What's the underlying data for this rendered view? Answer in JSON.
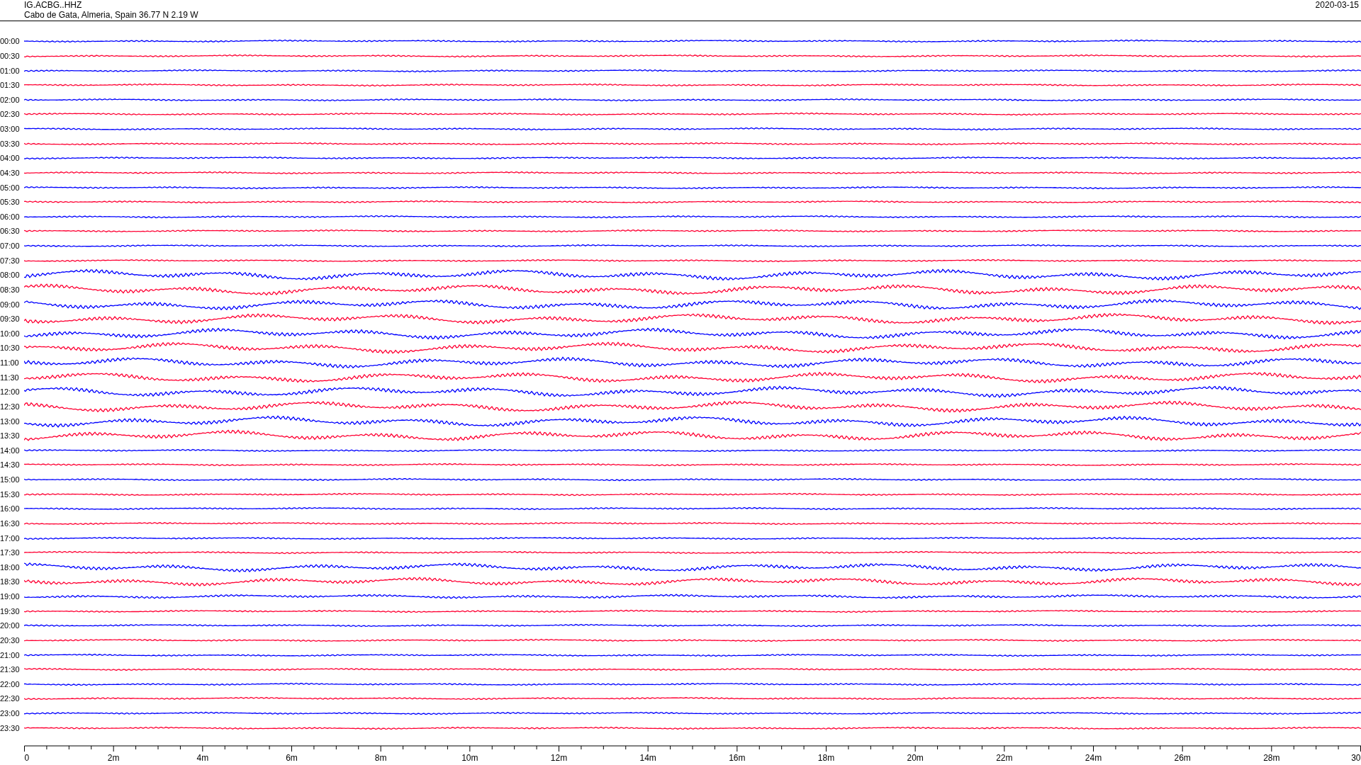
{
  "header": {
    "station": "IG.ACBG..HHZ",
    "location": "Cabo de Gata, Almeria, Spain  36.77 N 2.19 W",
    "date": "2020-03-15"
  },
  "traces": [
    {
      "time": "00:00",
      "color": "#0000ff"
    },
    {
      "time": "00:30",
      "color": "#ff0033"
    },
    {
      "time": "01:00",
      "color": "#0000ff"
    },
    {
      "time": "01:30",
      "color": "#ff0033"
    },
    {
      "time": "02:00",
      "color": "#0000ff"
    },
    {
      "time": "02:30",
      "color": "#ff0033"
    },
    {
      "time": "03:00",
      "color": "#0000ff"
    },
    {
      "time": "03:30",
      "color": "#ff0033"
    },
    {
      "time": "04:00",
      "color": "#0000ff"
    },
    {
      "time": "04:30",
      "color": "#ff0033"
    },
    {
      "time": "05:00",
      "color": "#0000ff"
    },
    {
      "time": "05:30",
      "color": "#ff0033"
    },
    {
      "time": "06:00",
      "color": "#0000ff"
    },
    {
      "time": "06:30",
      "color": "#ff0033"
    },
    {
      "time": "07:00",
      "color": "#0000ff"
    },
    {
      "time": "07:30",
      "color": "#ff0033"
    },
    {
      "time": "08:00",
      "color": "#0000ff"
    },
    {
      "time": "08:30",
      "color": "#ff0033"
    },
    {
      "time": "09:00",
      "color": "#0000ff"
    },
    {
      "time": "09:30",
      "color": "#ff0033"
    },
    {
      "time": "10:00",
      "color": "#0000ff"
    },
    {
      "time": "10:30",
      "color": "#ff0033"
    },
    {
      "time": "11:00",
      "color": "#0000ff"
    },
    {
      "time": "11:30",
      "color": "#ff0033"
    },
    {
      "time": "12:00",
      "color": "#0000ff"
    },
    {
      "time": "12:30",
      "color": "#ff0033"
    },
    {
      "time": "13:00",
      "color": "#0000ff"
    },
    {
      "time": "13:30",
      "color": "#ff0033"
    },
    {
      "time": "14:00",
      "color": "#0000ff"
    },
    {
      "time": "14:30",
      "color": "#ff0033"
    },
    {
      "time": "15:00",
      "color": "#0000ff"
    },
    {
      "time": "15:30",
      "color": "#ff0033"
    },
    {
      "time": "16:00",
      "color": "#0000ff"
    },
    {
      "time": "16:30",
      "color": "#ff0033"
    },
    {
      "time": "17:00",
      "color": "#0000ff"
    },
    {
      "time": "17:30",
      "color": "#ff0033"
    },
    {
      "time": "18:00",
      "color": "#0000ff"
    },
    {
      "time": "18:30",
      "color": "#ff0033"
    },
    {
      "time": "19:00",
      "color": "#0000ff"
    },
    {
      "time": "19:30",
      "color": "#ff0033"
    },
    {
      "time": "20:00",
      "color": "#0000ff"
    },
    {
      "time": "20:30",
      "color": "#ff0033"
    },
    {
      "time": "21:00",
      "color": "#0000ff"
    },
    {
      "time": "21:30",
      "color": "#ff0033"
    },
    {
      "time": "22:00",
      "color": "#0000ff"
    },
    {
      "time": "22:30",
      "color": "#ff0033"
    },
    {
      "time": "23:00",
      "color": "#0000ff"
    },
    {
      "time": "23:30",
      "color": "#ff0033"
    }
  ],
  "x_axis": {
    "labels": [
      "0",
      "2m",
      "4m",
      "6m",
      "8m",
      "10m",
      "12m",
      "14m",
      "16m",
      "18m",
      "20m",
      "22m",
      "24m",
      "26m",
      "28m",
      "30"
    ]
  }
}
